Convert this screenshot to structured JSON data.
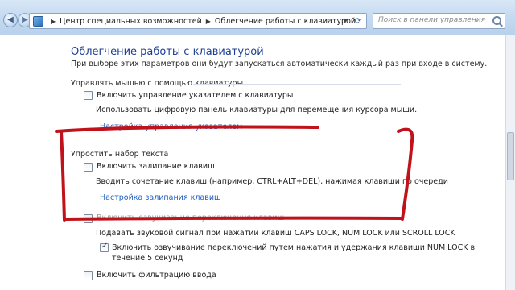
{
  "window": {
    "breadcrumb": [
      "Центр специальных возможностей",
      "Облегчение работы с клавиатурой"
    ],
    "search_placeholder": "Поиск в панели управления"
  },
  "page": {
    "title": "Облегчение работы с клавиатурой",
    "subtitle": "При выборе этих параметров они будут запускаться автоматически каждый раз при входе в систему."
  },
  "sections": {
    "mouse_keys": {
      "header": "Управлять мышью с помощью клавиатуры",
      "checkbox_label": "Включить управление указателем с клавиатуры",
      "checked": false,
      "description": "Использовать цифровую панель клавиатуры для перемещения курсора мыши.",
      "link": "Настройка управления указателем"
    },
    "sticky_keys": {
      "header": "Упростить набор текста",
      "checkbox_label": "Включить залипание клавиш",
      "checked": false,
      "description": "Вводить сочетание клавиш (например, CTRL+ALT+DEL), нажимая клавиши по очереди",
      "link": "Настройка залипания клавиш"
    },
    "toggle_keys": {
      "checkbox_label": "Включить озвучивание переключения клавиш",
      "checked": false,
      "description": "Подавать звуковой сигнал при нажатии клавиш CAPS LOCK, NUM LOCK или SCROLL LOCK",
      "sub_checkbox_label_line1": "Включить озвучивание переключений путем нажатия и удержания клавиши NUM LOCK в",
      "sub_checkbox_label_line2": "течение 5 секунд",
      "sub_checked": true
    },
    "filter_keys": {
      "checkbox_label": "Включить фильтрацию ввода",
      "checked": false
    }
  },
  "colors": {
    "title": "#1c3f94",
    "link": "#1f5fbf",
    "annotation": "#c0121a"
  }
}
